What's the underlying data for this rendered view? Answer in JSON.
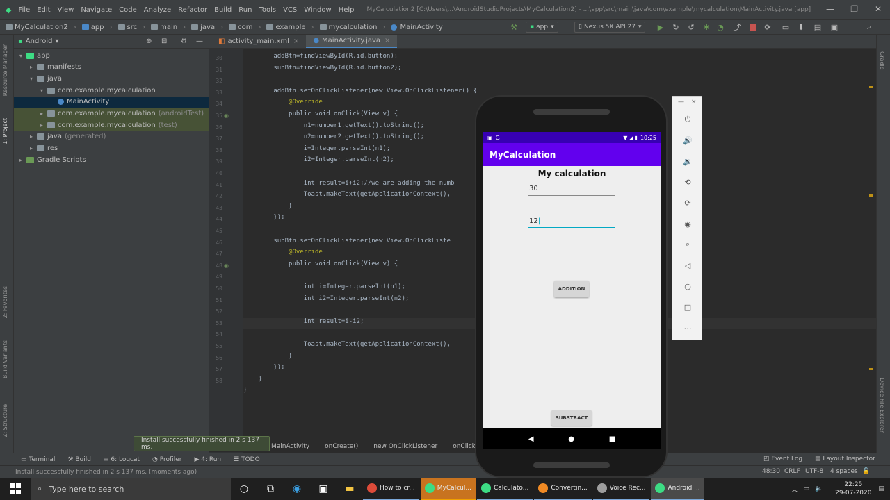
{
  "menubar": {
    "items": [
      "File",
      "Edit",
      "View",
      "Navigate",
      "Code",
      "Analyze",
      "Refactor",
      "Build",
      "Run",
      "Tools",
      "VCS",
      "Window",
      "Help"
    ],
    "title": "MyCalculation2 [C:\\Users\\...\\AndroidStudioProjects\\MyCalculation2] - ...\\app\\src\\main\\java\\com\\example\\mycalculation\\MainActivity.java [app]"
  },
  "navbar": {
    "crumbs": [
      "MyCalculation2",
      "app",
      "src",
      "main",
      "java",
      "com",
      "example",
      "mycalculation",
      "MainActivity"
    ],
    "run_config": "app",
    "device": "Nexus 5X API 27"
  },
  "sidebar_left": [
    "Resource Manager",
    "1: Project",
    "2: Favorites",
    "Build Variants",
    "Z: Structure"
  ],
  "sidebar_right": [
    "Gradle",
    "Device File Explorer"
  ],
  "project": {
    "view": "Android",
    "tree": [
      {
        "label": "app",
        "depth": 0,
        "arrow": "▾",
        "kind": "module"
      },
      {
        "label": "manifests",
        "depth": 1,
        "arrow": "▸",
        "kind": "folder"
      },
      {
        "label": "java",
        "depth": 1,
        "arrow": "▾",
        "kind": "folder"
      },
      {
        "label": "com.example.mycalculation",
        "depth": 2,
        "arrow": "▾",
        "kind": "package"
      },
      {
        "label": "MainActivity",
        "depth": 3,
        "arrow": "",
        "kind": "class"
      },
      {
        "label": "com.example.mycalculation",
        "suffix": "(androidTest)",
        "depth": 2,
        "arrow": "▸",
        "kind": "package"
      },
      {
        "label": "com.example.mycalculation",
        "suffix": "(test)",
        "depth": 2,
        "arrow": "▸",
        "kind": "package"
      },
      {
        "label": "java",
        "suffix": "(generated)",
        "depth": 1,
        "arrow": "▸",
        "kind": "folder"
      },
      {
        "label": "res",
        "depth": 1,
        "arrow": "▸",
        "kind": "folder"
      },
      {
        "label": "Gradle Scripts",
        "depth": 0,
        "arrow": "▸",
        "kind": "gradle"
      }
    ]
  },
  "editor": {
    "tabs": [
      "activity_main.xml",
      "MainActivity.java"
    ],
    "line_numbers": [
      "30",
      "31",
      "32",
      "33",
      "34",
      "35",
      "36",
      "37",
      "38",
      "39",
      "40",
      "41",
      "42",
      "43",
      "44",
      "45",
      "46",
      "47",
      "48",
      "49",
      "50",
      "51",
      "52",
      "53",
      "54",
      "55",
      "56",
      "57",
      "58"
    ],
    "lines": [
      "        addBtn=findViewById(R.id.button);",
      "        subBtn=findViewById(R.id.button2);",
      "",
      "        addBtn.setOnClickListener(new View.OnClickListener() {",
      "            @Override",
      "            public void onClick(View v) {",
      "                n1=number1.getText().toString();",
      "                n2=number2.getText().toString();",
      "                i=Integer.parseInt(n1);",
      "                i2=Integer.parseInt(n2);",
      "",
      "                int result=i+i2;//we are adding the numb",
      "                Toast.makeText(getApplicationContext(),",
      "            }",
      "        });",
      "",
      "        subBtn.setOnClickListener(new View.OnClickListe",
      "            @Override",
      "            public void onClick(View v) {",
      "",
      "                int i=Integer.parseInt(n1);",
      "                int i2=Integer.parseInt(n2);",
      "",
      "                int result=i-i2;",
      "",
      "                Toast.makeText(getApplicationContext(),",
      "            }",
      "        });",
      "    }",
      "}"
    ],
    "breadcrumbs": [
      "MainActivity",
      "onCreate()",
      "new OnClickListener",
      "onClick()"
    ]
  },
  "toolwindows": [
    "Terminal",
    "Build",
    "6: Logcat",
    "Profiler",
    "4: Run",
    "TODO"
  ],
  "toolwindows_right": [
    "Event Log",
    "Layout Inspector"
  ],
  "notification": "Install successfully finished in 2 s 137 ms.",
  "statusbar": {
    "text": "Install successfully finished in 2 s 137 ms. (moments ago)",
    "position": "48:30",
    "line_sep": "CRLF",
    "encoding": "UTF-8",
    "indent": "4 spaces"
  },
  "phone": {
    "time": "10:25",
    "app_title": "MyCalculation",
    "heading": "My calculation",
    "number1": "30",
    "number2": "12",
    "add_label": "ADDITION",
    "sub_label": "SUBSTRACT",
    "accent": "#6200ee",
    "status_color": "#3700b3"
  },
  "emulator_tools": [
    "power-icon",
    "volume-up-icon",
    "volume-down-icon",
    "rotate-left-icon",
    "rotate-right-icon",
    "camera-icon",
    "zoom-icon",
    "back-icon",
    "home-icon",
    "overview-icon",
    "more-icon"
  ],
  "taskbar": {
    "search_placeholder": "Type here to search",
    "apps": [
      {
        "label": "How to cr...",
        "color": "#dd4b39"
      },
      {
        "label": "MyCalcul...",
        "color": "#3ddc84"
      },
      {
        "label": "Calculato...",
        "color": "#3ddc84"
      },
      {
        "label": "Convertin...",
        "color": "#f08a24"
      },
      {
        "label": "Voice Rec...",
        "color": "#9e9e9e"
      },
      {
        "label": "Android ...",
        "color": "#3ddc84"
      }
    ],
    "time": "22:25",
    "date": "29-07-2020"
  }
}
